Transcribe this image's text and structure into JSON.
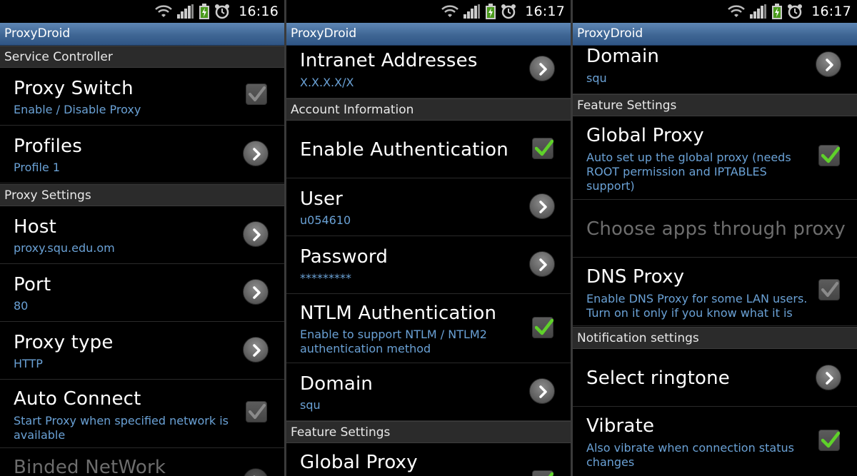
{
  "time_left": "16:16",
  "time_right": "16:17",
  "app_title": "ProxyDroid",
  "icons": [
    "wifi-icon",
    "signal-icon",
    "battery-icon",
    "alarm-icon",
    "chevron-right-icon",
    "checkbox-icon"
  ],
  "colors": {
    "summary": "#6aa1d5",
    "check_green": "#5fd12a",
    "titlebar": "#3f6694"
  },
  "p1": {
    "cat_service": "Service Controller",
    "proxy_switch": {
      "title": "Proxy Switch",
      "summary": "Enable / Disable Proxy",
      "checked": true
    },
    "profiles": {
      "title": "Profiles",
      "summary": "Profile 1"
    },
    "cat_proxy": "Proxy Settings",
    "host": {
      "title": "Host",
      "summary": "proxy.squ.edu.om"
    },
    "port": {
      "title": "Port",
      "summary": "80"
    },
    "proxy_type": {
      "title": "Proxy type",
      "summary": "HTTP"
    },
    "auto_connect": {
      "title": "Auto Connect",
      "summary1": "Start Proxy when specified network is",
      "summary2": "available",
      "checked": true
    },
    "binded_network": {
      "title": "Binded NetWork"
    }
  },
  "p2": {
    "intranet": {
      "title": "Intranet Addresses",
      "summary": "X.X.X.X/X"
    },
    "cat_account": "Account Information",
    "enable_auth": {
      "title": "Enable Authentication",
      "checked": true
    },
    "user": {
      "title": "User",
      "summary": "u054610"
    },
    "password": {
      "title": "Password",
      "summary": "*********"
    },
    "ntlm": {
      "title": "NTLM Authentication",
      "summary1": "Enable to support NTLM / NTLM2",
      "summary2": "authentication method",
      "checked": true
    },
    "domain": {
      "title": "Domain",
      "summary": "squ"
    },
    "cat_feature": "Feature Settings",
    "global_proxy": {
      "title": "Global Proxy"
    }
  },
  "p3": {
    "domain": {
      "title": "Domain",
      "summary": "squ"
    },
    "cat_feature": "Feature Settings",
    "global_proxy": {
      "title": "Global Proxy",
      "summary1": "Auto set up the global proxy (needs",
      "summary2": "ROOT permission and IPTABLES",
      "summary3": "support)",
      "checked": true
    },
    "choose_apps": {
      "title": "Choose apps through proxy"
    },
    "dns_proxy": {
      "title": "DNS Proxy",
      "summary1": "Enable DNS Proxy for some LAN users.",
      "summary2": "Turn on it only if you know what it is",
      "checked": true
    },
    "cat_notification": "Notification settings",
    "ringtone": {
      "title": "Select ringtone"
    },
    "vibrate": {
      "title": "Vibrate",
      "summary1": "Also vibrate when connection status",
      "summary2": "changes",
      "checked": true
    }
  }
}
